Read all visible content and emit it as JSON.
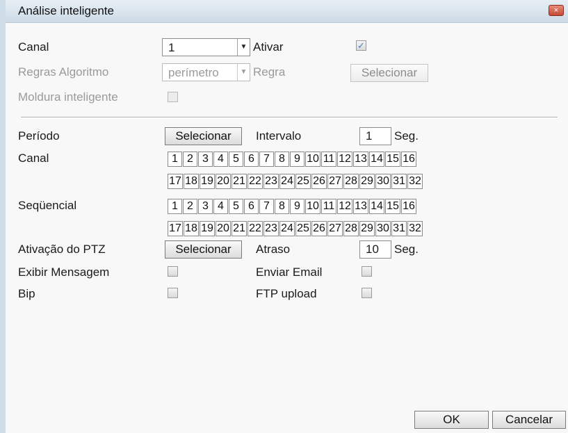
{
  "window": {
    "title": "Análise inteligente",
    "close_glyph": "×"
  },
  "top": {
    "canal_label": "Canal",
    "canal_value": "1",
    "ativar_label": "Ativar",
    "ativar_checked": true,
    "regras_label": "Regras Algoritmo",
    "regras_value": "perímetro",
    "regra_label": "Regra",
    "regra_button": "Selecionar",
    "moldura_label": "Moldura inteligente",
    "moldura_checked": false
  },
  "bottom": {
    "periodo_label": "Período",
    "periodo_button": "Selecionar",
    "intervalo_label": "Intervalo",
    "intervalo_value": "1",
    "intervalo_unit": "Seg.",
    "canal_label": "Canal",
    "sequencial_label": "Seqüencial",
    "channels_row1": [
      "1",
      "2",
      "3",
      "4",
      "5",
      "6",
      "7",
      "8",
      "9",
      "10",
      "11",
      "12",
      "13",
      "14",
      "15",
      "16"
    ],
    "channels_row2": [
      "17",
      "18",
      "19",
      "20",
      "21",
      "22",
      "23",
      "24",
      "25",
      "26",
      "27",
      "28",
      "29",
      "30",
      "31",
      "32"
    ],
    "ptz_label": "Ativação do PTZ",
    "ptz_button": "Selecionar",
    "atraso_label": "Atraso",
    "atraso_value": "10",
    "atraso_unit": "Seg.",
    "exibir_label": "Exibir Mensagem",
    "enviar_email_label": "Enviar Email",
    "bip_label": "Bip",
    "ftp_label": "FTP upload"
  },
  "footer": {
    "ok_label": "OK",
    "cancel_label": "Cancelar"
  },
  "icons": {
    "dropdown": "chevron-down-icon",
    "check": "checkmark-icon",
    "close": "close-icon"
  }
}
